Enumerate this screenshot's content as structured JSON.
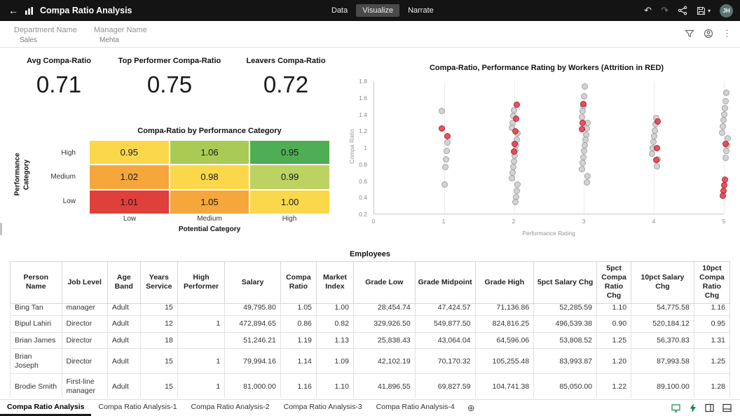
{
  "icons": {
    "back": "←",
    "undo": "↶",
    "redo": "↷",
    "more_vertical": "⋮",
    "add_canvas": "⊕",
    "caret_down": "▾"
  },
  "topbar": {
    "title": "Compa Ratio Analysis",
    "tabs": [
      {
        "label": "Data",
        "active": false
      },
      {
        "label": "Visualize",
        "active": true
      },
      {
        "label": "Narrate",
        "active": false
      }
    ],
    "avatar_initials": "JH"
  },
  "filter_bar": {
    "filters": [
      {
        "label": "Department Name",
        "value": "Sales"
      },
      {
        "label": "Manager Name",
        "value": "Mehta"
      }
    ]
  },
  "kpis": [
    {
      "label": "Avg Compa-Ratio",
      "value": "0.71"
    },
    {
      "label": "Top Performer Compa-Ratio",
      "value": "0.75"
    },
    {
      "label": "Leavers Compa-Ratio",
      "value": "0.72"
    }
  ],
  "chart_data": [
    {
      "type": "heatmap",
      "title": "Compa-Ratio by Performance Category",
      "ylabel": "Performance Category",
      "xlabel": "Potential Category",
      "row_labels": [
        "High",
        "Medium",
        "Low"
      ],
      "col_labels": [
        "Low",
        "Medium",
        "High"
      ],
      "values": [
        [
          "0.95",
          "1.06",
          "0.95"
        ],
        [
          "1.02",
          "0.98",
          "0.99"
        ],
        [
          "1.01",
          "1.05",
          "1.00"
        ]
      ],
      "cell_colors": [
        [
          "#FBD84B",
          "#A9CB55",
          "#4FAE55"
        ],
        [
          "#F5A73C",
          "#FBD84B",
          "#BCD262"
        ],
        [
          "#E0403C",
          "#F5A73C",
          "#FBD84B"
        ]
      ]
    },
    {
      "type": "scatter",
      "title": "Compa-Ratio, Performance Rating by Workers (Attrition in RED)",
      "xlabel": "Performance Rating",
      "ylabel": "Compa Ratio",
      "xlim": [
        0,
        5
      ],
      "ylim": [
        0.2,
        1.8
      ],
      "xticks": [
        "0",
        "1",
        "2",
        "3",
        "4",
        "5"
      ],
      "yticks": [
        "0.2",
        "0.4",
        "0.6",
        "0.8",
        "1",
        "1.2",
        "1.4",
        "1.6",
        "1.8"
      ],
      "legend": "off",
      "grid": "vertical",
      "series": [
        {
          "name": "Workers",
          "color": "#cfcfcf",
          "border": "#9b9b9b",
          "points": [
            [
              1,
              1.44
            ],
            [
              1,
              1.06
            ],
            [
              1,
              0.96
            ],
            [
              1,
              0.86
            ],
            [
              1,
              0.77
            ],
            [
              1,
              0.56
            ],
            [
              2,
              1.45
            ],
            [
              2,
              1.38
            ],
            [
              2,
              1.3
            ],
            [
              2,
              1.24
            ],
            [
              2,
              1.17
            ],
            [
              2,
              1.1
            ],
            [
              2,
              1.03
            ],
            [
              2,
              0.97
            ],
            [
              2,
              0.9
            ],
            [
              2,
              0.84
            ],
            [
              2,
              0.77
            ],
            [
              2,
              0.7
            ],
            [
              2,
              0.63
            ],
            [
              2,
              0.56
            ],
            [
              2,
              0.48
            ],
            [
              2,
              0.41
            ],
            [
              2,
              0.35
            ],
            [
              3,
              1.74
            ],
            [
              3,
              1.62
            ],
            [
              3,
              1.5
            ],
            [
              3,
              1.44
            ],
            [
              3,
              1.37
            ],
            [
              3,
              1.3
            ],
            [
              3,
              1.23
            ],
            [
              3,
              1.16
            ],
            [
              3,
              1.1
            ],
            [
              3,
              1.03
            ],
            [
              3,
              0.96
            ],
            [
              3,
              0.89
            ],
            [
              3,
              0.82
            ],
            [
              3,
              0.74
            ],
            [
              3,
              0.66
            ],
            [
              3,
              0.58
            ],
            [
              4,
              1.36
            ],
            [
              4,
              1.28
            ],
            [
              4,
              1.21
            ],
            [
              4,
              1.14
            ],
            [
              4,
              1.07
            ],
            [
              4,
              1.0
            ],
            [
              4,
              0.93
            ],
            [
              4,
              0.86
            ],
            [
              4,
              0.78
            ],
            [
              5,
              1.66
            ],
            [
              5,
              1.56
            ],
            [
              5,
              1.48
            ],
            [
              5,
              1.4
            ],
            [
              5,
              1.33
            ],
            [
              5,
              1.26
            ],
            [
              5,
              1.18
            ],
            [
              5,
              1.11
            ],
            [
              5,
              1.03
            ],
            [
              5,
              0.96
            ],
            [
              5,
              0.88
            ]
          ]
        },
        {
          "name": "Attrition",
          "color": "#e8404e",
          "border": "#a8122b",
          "points": [
            [
              1,
              1.23
            ],
            [
              1,
              1.14
            ],
            [
              2,
              1.52
            ],
            [
              2,
              1.35
            ],
            [
              2,
              1.2
            ],
            [
              2,
              1.05
            ],
            [
              2,
              0.95
            ],
            [
              3,
              1.53
            ],
            [
              3,
              1.3
            ],
            [
              3,
              1.22
            ],
            [
              4,
              1.32
            ],
            [
              4,
              1.0
            ],
            [
              4,
              0.85
            ],
            [
              5,
              1.05
            ],
            [
              5,
              0.62
            ],
            [
              5,
              0.55
            ],
            [
              5,
              0.48
            ],
            [
              5,
              0.42
            ]
          ]
        }
      ]
    }
  ],
  "table": {
    "title": "Employees",
    "columns": [
      "Person Name",
      "Job Level",
      "Age Band",
      "Years Service",
      "High Performer",
      "Salary",
      "Compa Ratio",
      "Market Index",
      "Grade Low",
      "Grade Midpoint",
      "Grade High",
      "5pct Salary Chg",
      "5pct Compa Ratio Chg",
      "10pct Salary Chg",
      "10pct Compa Ratio Chg"
    ],
    "rows": [
      [
        "Bing Tan",
        "manager",
        "Adult",
        "15",
        "",
        "49,795.80",
        "1.05",
        "1.00",
        "28,454.74",
        "47,424.57",
        "71,136.86",
        "52,285.59",
        "1.10",
        "54,775.58",
        "1.16"
      ],
      [
        "Bipul Lahiri",
        "Director",
        "Adult",
        "12",
        "1",
        "472,894.65",
        "0.86",
        "0.82",
        "329,926.50",
        "549,877.50",
        "824,816.25",
        "496,539.38",
        "0.90",
        "520,184.12",
        "0.95"
      ],
      [
        "Brian James",
        "Director",
        "Adult",
        "18",
        "",
        "51,246.21",
        "1.19",
        "1.13",
        "25,838.43",
        "43,064.04",
        "64,596.06",
        "53,808.52",
        "1.25",
        "56,370.83",
        "1.31"
      ],
      [
        "Brian Joseph",
        "Director",
        "Adult",
        "15",
        "1",
        "79,994.16",
        "1.14",
        "1.09",
        "42,102.19",
        "70,170.32",
        "105,255.48",
        "83,993.87",
        "1.20",
        "87,993.58",
        "1.25"
      ],
      [
        "Brodie Smith",
        "First-line manager",
        "Adult",
        "15",
        "1",
        "81,000.00",
        "1.16",
        "1.10",
        "41,896.55",
        "69,827.59",
        "104,741.38",
        "85,050.00",
        "1.22",
        "89,100.00",
        "1.28"
      ]
    ]
  },
  "bottom_bar": {
    "tabs": [
      {
        "label": "Compa Ratio Analysis",
        "active": true
      },
      {
        "label": "Compa Ratio Analysis-1",
        "active": false
      },
      {
        "label": "Compa Ratio Analysis-2",
        "active": false
      },
      {
        "label": "Compa Ratio Analysis-3",
        "active": false
      },
      {
        "label": "Compa Ratio Analysis-4",
        "active": false
      }
    ]
  }
}
